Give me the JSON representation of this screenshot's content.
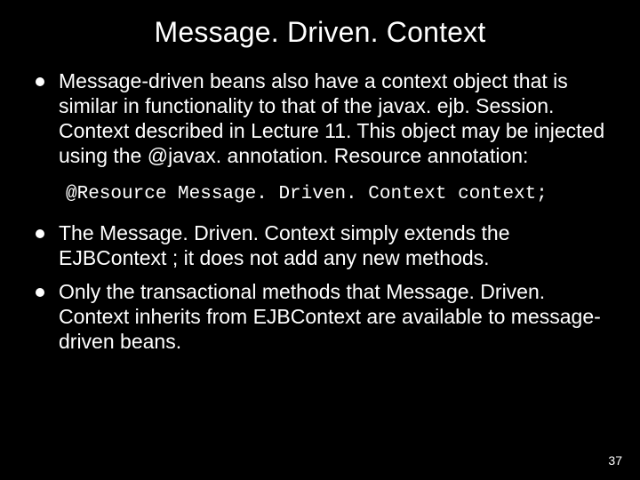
{
  "title": "Message. Driven. Context",
  "bullets_top": [
    "Message-driven beans also have a context object that is similar in functionality to that of the javax. ejb. Session. Context described in Lecture 11. This object may be injected using the @javax. annotation. Resource annotation:"
  ],
  "code": "@Resource Message. Driven. Context context;",
  "bullets_bottom": [
    "The Message. Driven. Context simply extends the EJBContext ; it does not add any new methods.",
    "Only the transactional methods that Message. Driven. Context inherits from EJBContext are available to message-driven beans."
  ],
  "page_number": "37"
}
